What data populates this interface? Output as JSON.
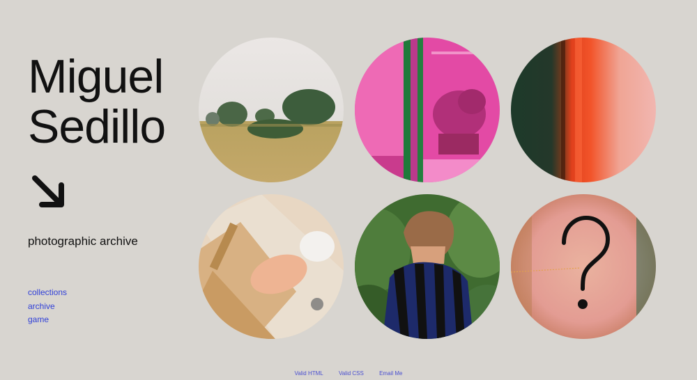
{
  "header": {
    "name_line1": "Miguel",
    "name_line2": "Sedillo",
    "subtitle": "photographic archive"
  },
  "nav": {
    "items": [
      "collections",
      "archive",
      "game"
    ]
  },
  "gallery": {
    "items": [
      {
        "icon": "landscape-field-photo"
      },
      {
        "icon": "pink-greenhouse-photo"
      },
      {
        "icon": "film-light-leak-photo"
      },
      {
        "icon": "woodwork-hands-photo"
      },
      {
        "icon": "boy-striped-shirt-photo"
      },
      {
        "icon": "question-mark-icon",
        "glyph": "?"
      }
    ]
  },
  "footer": {
    "links": [
      "Valid HTML",
      "Valid CSS",
      "Email Me"
    ]
  },
  "colors": {
    "background": "#d8d5d0",
    "text": "#111111",
    "link": "#2f3fd8"
  }
}
